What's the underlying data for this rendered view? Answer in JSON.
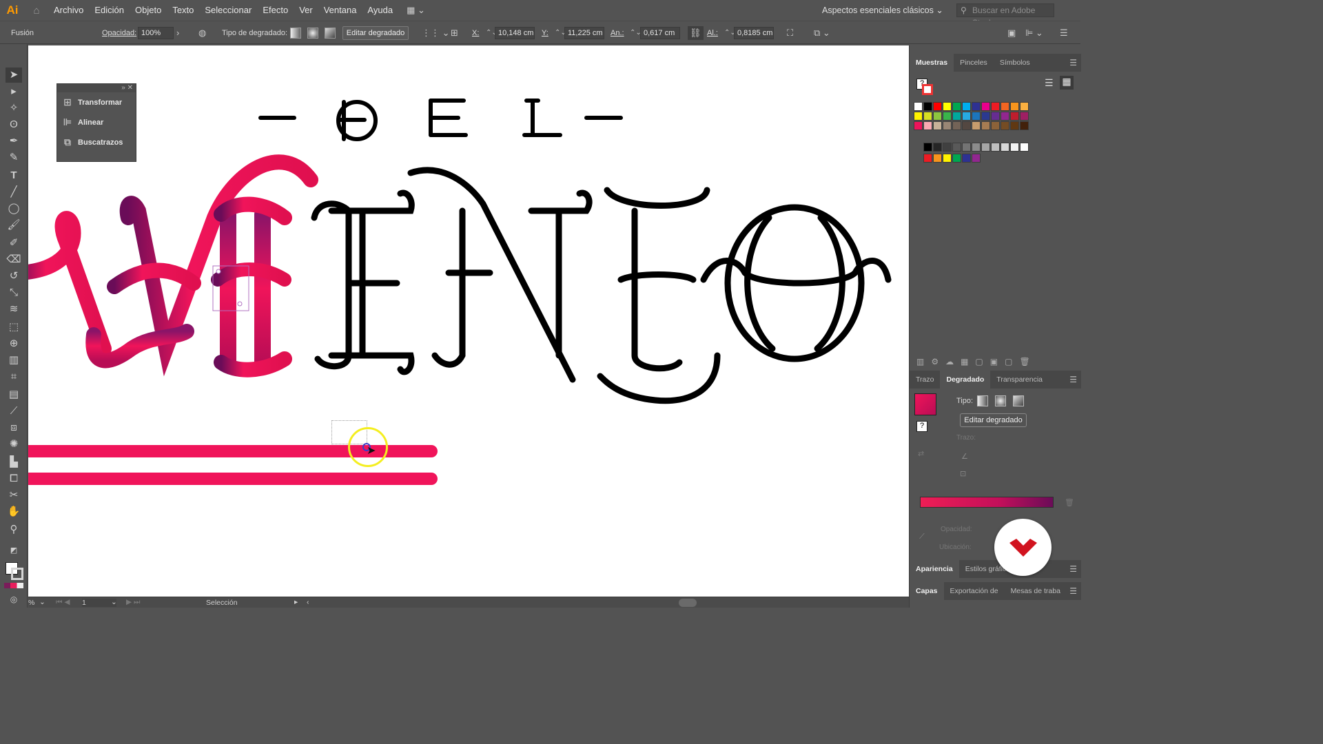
{
  "app": {
    "logo": "Ai"
  },
  "menu": [
    "Archivo",
    "Edición",
    "Objeto",
    "Texto",
    "Seleccionar",
    "Efecto",
    "Ver",
    "Ventana",
    "Ayuda"
  ],
  "workspace": "Aspectos esenciales clásicos",
  "search_placeholder": "Buscar en Adobe Stock",
  "control": {
    "mode": "Fusión",
    "opacity_label": "Opacidad:",
    "opacity_value": "100%",
    "gradient_type_label": "Tipo de degradado:",
    "edit_gradient": "Editar degradado",
    "x_label": "X:",
    "x_value": "10,148 cm",
    "y_label": "Y:",
    "y_value": "11,225 cm",
    "w_label": "An.:",
    "w_value": "0,617 cm",
    "h_label": "Al.:",
    "h_value": "0,8185 cm"
  },
  "float_panel": {
    "items": [
      "Transformar",
      "Alinear",
      "Buscatrazos"
    ]
  },
  "swatches_panel": {
    "tabs": [
      "Muestras",
      "Pinceles",
      "Símbolos"
    ],
    "active": "Muestras"
  },
  "gradient_panel": {
    "tabs": [
      "Trazo",
      "Degradado",
      "Transparencia"
    ],
    "active": "Degradado",
    "tipo_label": "Tipo:",
    "edit_button": "Editar degradado",
    "trazo_label": "Trazo:",
    "opacity_label": "Opacidad:",
    "location_label": "Ubicación:",
    "colors": {
      "start": "#ee1e55",
      "end": "#6a0c58"
    }
  },
  "appearance_tabs": [
    "Apariencia",
    "Estilos gráficos"
  ],
  "layers_tabs": [
    "Capas",
    "Exportación de",
    "Mesas de traba"
  ],
  "status": {
    "zoom": "%",
    "artboard": "1",
    "tool": "Selección"
  },
  "artwork": {
    "top_line": "— D E L —",
    "main_word": "VIENTO",
    "accent": "#f0145a",
    "ink": "#000000"
  },
  "swatch_colors": [
    [
      "#ffffff",
      "#000000",
      "#ff0000",
      "#ffff00",
      "#00a651",
      "#00aeef",
      "#2e3192",
      "#ec008c",
      "#ed1c24",
      "#f26522",
      "#f7941d",
      "#fbb040"
    ],
    [
      "#fff200",
      "#d7df23",
      "#8dc63f",
      "#39b54a",
      "#00a99d",
      "#27aae1",
      "#1c75bc",
      "#2b3990",
      "#662d91",
      "#92278f",
      "#be1e2d",
      "#9e1f63"
    ],
    [
      "#ed145b",
      "#f9a9b2",
      "#c7b299",
      "#998675",
      "#736357",
      "#534741",
      "#c69c6d",
      "#a67c52",
      "#8c6239",
      "#754c24",
      "#603813",
      "#42210b"
    ],
    [
      "#000000",
      "#262626",
      "#404040",
      "#595959",
      "#737373",
      "#8c8c8c",
      "#a6a6a6",
      "#bfbfbf",
      "#d9d9d9",
      "#f2f2f2",
      "#ffffff"
    ],
    [
      "#ed1c24",
      "#f7941d",
      "#fff200",
      "#00a651",
      "#2e3192",
      "#92278f"
    ]
  ]
}
